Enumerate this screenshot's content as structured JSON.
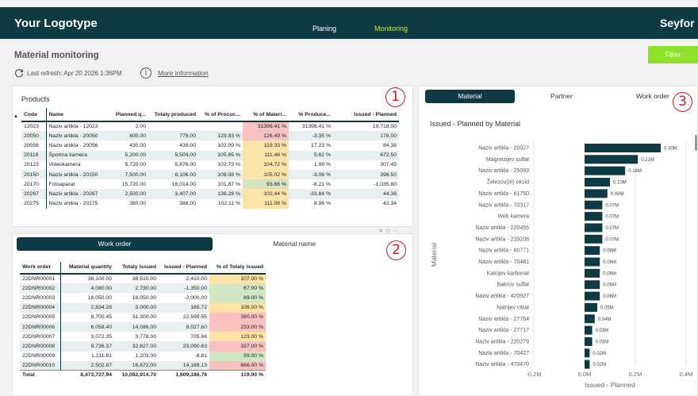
{
  "header": {
    "logo": "Your Logotype",
    "nav": [
      "Planing",
      "Monitoring"
    ],
    "brand": "Seyfor"
  },
  "page": {
    "title": "Material monitoring",
    "refresh": "Last refresh: Apr 20 2026 1:36PM",
    "more_info": "More information",
    "filter_label": "Filter"
  },
  "badges": [
    "1",
    "2",
    "3"
  ],
  "products": {
    "title": "Products",
    "columns": [
      "Code",
      "Name",
      "Planned q...",
      "Totaly produced",
      "% of Procuc...",
      "% of Materi...",
      "% Produce...",
      "Issued - Planned"
    ],
    "rows": [
      [
        "12023",
        "Naziv artikla - 12023",
        "2.00",
        "",
        "",
        "31398.41 %",
        "31398.41 %",
        "19,718.00"
      ],
      [
        "20050",
        "Naziv artikla - 20050",
        "600.00",
        "779.00",
        "129.83 %",
        "126.49 %",
        "-3.35 %",
        "178.00"
      ],
      [
        "20056",
        "Naziv artikla - 20056",
        "430.00",
        "439.00",
        "102.09 %",
        "119.33 %",
        "17.23 %",
        "84.38"
      ],
      [
        "20116",
        "Športna kamera",
        "5,200.00",
        "5,504.00",
        "105.85 %",
        "111.46 %",
        "5.62 %",
        "672.50"
      ],
      [
        "20123",
        "Videokamera",
        "5,720.00",
        "5,876.00",
        "102.73 %",
        "104.72 %",
        "1.99 %",
        "307.45"
      ],
      [
        "20150",
        "Naziv artikla - 20150",
        "7,500.00",
        "8,106.00",
        "108.08 %",
        "105.02 %",
        "-3.06 %",
        "398.50"
      ],
      [
        "20170",
        "Fotoaparat",
        "15,720.00",
        "16,014.00",
        "101.87 %",
        "93.66 %",
        "-8.21 %",
        "-1,035.80"
      ],
      [
        "20267",
        "Naziv artikla - 20267",
        "2,500.00",
        "3,407.00",
        "136.28 %",
        "102.44 %",
        "-33.84 %",
        "44.36"
      ],
      [
        "20275",
        "Naziv artikla - 20275",
        "380.00",
        "388.00",
        "102.11 %",
        "111.06 %",
        "8.96 %",
        "42.34"
      ]
    ]
  },
  "work": {
    "tabs": [
      "Work order",
      "Material name"
    ],
    "columns": [
      "Work order",
      "Material quantity",
      "Totaly issued",
      "Issued - Planned",
      "% of Totaly issued"
    ],
    "rows": [
      [
        "22DNR00001",
        "36,100.00",
        "38,510.00",
        "2,410.00",
        "107.00 %"
      ],
      [
        "22DNR00002",
        "4,080.00",
        "2,730.00",
        "-1,350.00",
        "67.00 %"
      ],
      [
        "22DNR00003",
        "18,050.00",
        "16,050.00",
        "-2,000.00",
        "89.00 %"
      ],
      [
        "22DNR00004",
        "2,834.28",
        "3,000.00",
        "165.72",
        "106.00 %"
      ],
      [
        "22DNR00005",
        "8,700.45",
        "31,300.00",
        "22,599.55",
        "360.00 %"
      ],
      [
        "22DNR00006",
        "6,058.40",
        "14,086.00",
        "8,027.60",
        "233.00 %"
      ],
      [
        "22DNR00007",
        "3,072.35",
        "3,778.00",
        "705.66",
        "123.00 %"
      ],
      [
        "22DNR00008",
        "9,736.37",
        "32,827.00",
        "23,090.63",
        "337.00 %"
      ],
      [
        "22DNR00009",
        "1,211.81",
        "1,203.00",
        "-8.81",
        "99.00 %"
      ],
      [
        "22DNR00010",
        "2,502.87",
        "16,672.00",
        "14,169.13",
        "666.00 %"
      ]
    ],
    "total": [
      "Total",
      "8,473,727.94",
      "10,082,914.70",
      "1,609,186.76",
      "119.00 %"
    ]
  },
  "right": {
    "tabs": [
      "Material",
      "Partner",
      "Work order"
    ]
  },
  "colors": {
    "dark": "#0e3a45",
    "accent": "#c5e64f",
    "filter": "#8ee02a",
    "bar": "#0e3a45"
  },
  "chart_data": {
    "type": "bar",
    "orientation": "horizontal",
    "title": "Issued - Planned by Material",
    "xlabel": "Issued - Planned",
    "ylabel": "Material",
    "xlim": [
      -0.2,
      0.4
    ],
    "xticks": [
      "-0.2M",
      "0.0M",
      "0.2M",
      "0.4M"
    ],
    "categories": [
      "Naziv artikla - 20927",
      "Magnezijev sulfat",
      "Naziv artikla - 25093",
      "Železov(III) oksid",
      "Naziv artikla - 61750",
      "Naziv artikla - 70317",
      "Web kamera",
      "Naziv artikla - 220455",
      "Naziv artikla - 220208",
      "Naziv artikla - 60771",
      "Naziv artikla - 70481",
      "Kalcijev karbonat",
      "Bakrov sulfat",
      "Naziv artikla - 420927",
      "Natrijev citrat",
      "Naziv artikla - 27764",
      "Naziv artikla - 27717",
      "Naziv artikla - 220279",
      "Naziv artikla - 70427",
      "Naziv artikla - 470470"
    ],
    "values": [
      0.3,
      0.21,
      0.16,
      0.1,
      0.09,
      0.07,
      0.07,
      0.07,
      0.07,
      0.06,
      0.06,
      0.06,
      0.06,
      0.06,
      0.05,
      0.04,
      0.03,
      0.03,
      0.02,
      0.02
    ],
    "labels": [
      "0.30M",
      "0.21M",
      "0.16M",
      "0.10M",
      "0.09M",
      "0.07M",
      "0.07M",
      "0.07M",
      "0.07M",
      "0.06M",
      "0.06M",
      "0.06M",
      "0.06M",
      "0.06M",
      "0.05M",
      "0.04M",
      "0.03M",
      "0.03M",
      "0.02M",
      "0.02M"
    ]
  }
}
